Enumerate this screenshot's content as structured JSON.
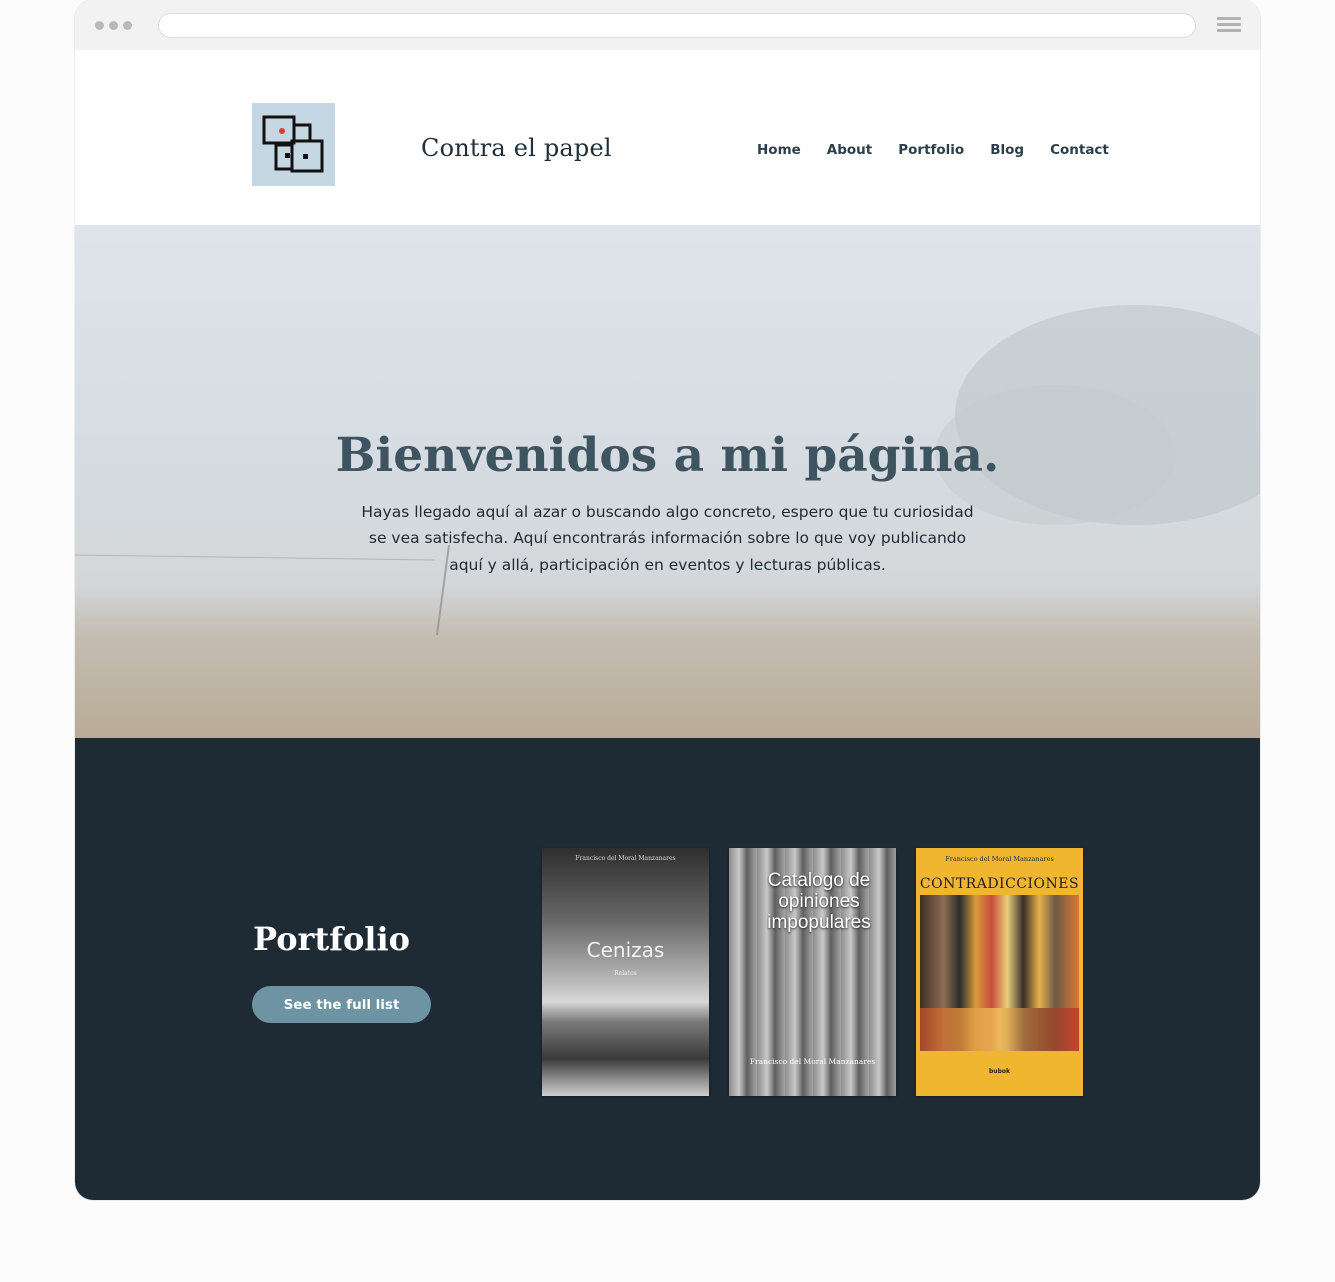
{
  "site": {
    "title": "Contra el papel",
    "nav": [
      "Home",
      "About",
      "Portfolio",
      "Blog",
      "Contact"
    ]
  },
  "hero": {
    "heading": "Bienvenidos a mi página.",
    "text": "Hayas llegado aquí al azar o buscando algo concreto, espero que tu curiosidad se vea satisfecha. Aquí encontrarás información sobre lo que voy publicando aquí y allá, participación en eventos y lecturas públicas."
  },
  "portfolio": {
    "heading": "Portfolio",
    "button_label": "See the full list",
    "books": [
      {
        "author": "Francisco del Moral Manzanares",
        "title": "Cenizas",
        "subtitle": "Relatos"
      },
      {
        "author": "Francisco del Moral Manzanares",
        "title": "Catalogo de opiniones impopulares"
      },
      {
        "author": "Francisco del Moral Manzanares",
        "title": "CONTRADICCIONES",
        "publisher": "bubok"
      }
    ]
  },
  "colors": {
    "accent": "#6e93a2",
    "dark_section": "#1f2b34",
    "title_text": "#3f5461",
    "logo_bg": "#c6d7e4",
    "logo_dot": "#e53935"
  },
  "icons": [
    "window-dots-icon",
    "menu-icon",
    "site-logo-icon"
  ]
}
